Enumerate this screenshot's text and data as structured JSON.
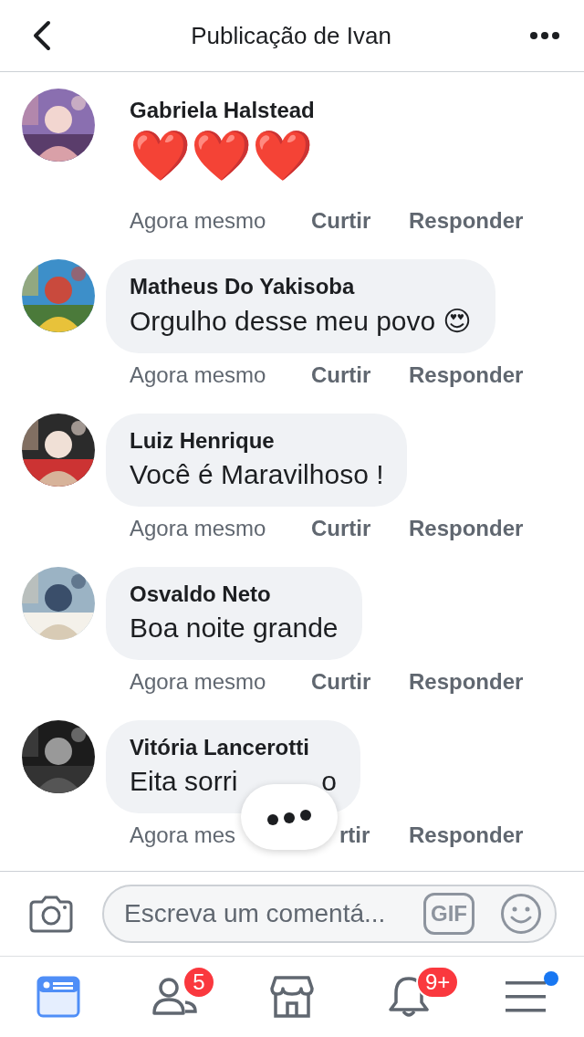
{
  "header": {
    "title": "Publicação de Ivan"
  },
  "comments": [
    {
      "author": "Gabriela Halstead",
      "kind": "plain",
      "text_parts": [
        "❤️❤️❤️"
      ],
      "time": "Agora mesmo",
      "like": "Curtir",
      "reply": "Responder"
    },
    {
      "author": "Matheus Do Yakisoba",
      "kind": "bubble",
      "text_parts": [
        "Orgulho desse meu povo 😍"
      ],
      "time": "Agora mesmo",
      "like": "Curtir",
      "reply": "Responder"
    },
    {
      "author": "Luiz Henrique",
      "kind": "bubble",
      "text_parts": [
        "Você é Maravilhoso !"
      ],
      "time": "Agora mesmo",
      "like": "Curtir",
      "reply": "Responder"
    },
    {
      "author": "Osvaldo Neto",
      "kind": "bubble",
      "text_parts": [
        "Boa noite grande"
      ],
      "time": "Agora mesmo",
      "like": "Curtir",
      "reply": "Responder"
    },
    {
      "author": "Vitória Lancerotti",
      "kind": "bubble",
      "text_parts": [
        "Eita sorri",
        "o"
      ],
      "time": "Agora mes",
      "like": "rtir",
      "reply": "Responder"
    }
  ],
  "typing_indicator": true,
  "composer": {
    "placeholder": "Escreva um comentá...",
    "gif_label": "GIF"
  },
  "tabs": [
    {
      "kind": "feed",
      "selected": true
    },
    {
      "kind": "friends",
      "selected": false,
      "badge": "5"
    },
    {
      "kind": "marketplace",
      "selected": false
    },
    {
      "kind": "notifications",
      "selected": false,
      "badge": "9+"
    },
    {
      "kind": "menu",
      "selected": false,
      "dot": true
    }
  ]
}
